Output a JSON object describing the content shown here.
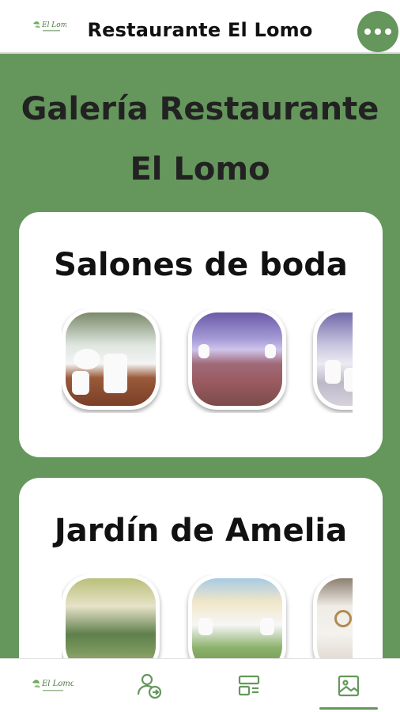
{
  "header": {
    "title": "Restaurante El Lomo",
    "logo_icon": "el-lomo-logo-icon",
    "menu_icon": "more-horizontal-icon"
  },
  "gallery": {
    "title_line1": "Galería Restaurante",
    "title_line2": "El Lomo"
  },
  "sections": [
    {
      "title": "Salones de boda",
      "images": [
        "wedding-hall-1",
        "wedding-hall-2",
        "wedding-hall-3"
      ]
    },
    {
      "title": "Jardín de Amelia",
      "images": [
        "garden-1",
        "garden-2",
        "garden-3"
      ]
    }
  ],
  "bottom_nav": {
    "items": [
      {
        "icon": "el-lomo-logo-icon",
        "active": false
      },
      {
        "icon": "user-arrow-icon",
        "active": false
      },
      {
        "icon": "menu-layout-icon",
        "active": false
      },
      {
        "icon": "gallery-image-icon",
        "active": true
      }
    ]
  },
  "colors": {
    "brand_green": "#65975c",
    "card_bg": "#ffffff",
    "title_text": "#222222"
  }
}
